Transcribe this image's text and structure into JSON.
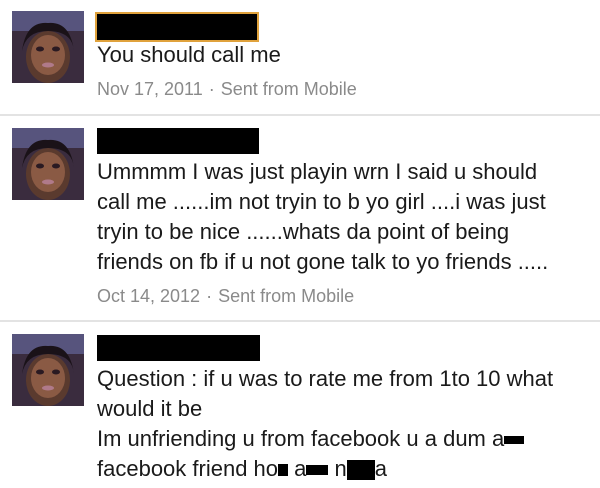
{
  "messages": [
    {
      "body_lines": [
        "You should call me"
      ],
      "date": "Nov 17, 2011",
      "separator": "·",
      "source": "Sent from Mobile"
    },
    {
      "body_lines": [
        "Ummmm I was just playin wrn I said u should",
        "call me ......im not tryin to b yo girl ....i was just",
        "tryin to be nice ......whats da point of being",
        "friends on fb if u not gone talk to yo friends ....."
      ],
      "date": "Oct 14, 2012",
      "separator": "·",
      "source": "Sent from Mobile"
    },
    {
      "body_lines": [
        "Question : if u was to rate me from 1to 10 what",
        "would it be",
        "Im unfriending u from facebook u a dum a",
        "facebook friend ho",
        "a",
        "n",
        "a"
      ]
    }
  ],
  "colors": {
    "text": "#1a1a1a",
    "meta": "#8a8a8a",
    "divider": "#e3e3e3",
    "selection_outline": "#e0a23c"
  },
  "icons": {
    "avatar": "profile-photo",
    "redaction": "black-bar"
  }
}
